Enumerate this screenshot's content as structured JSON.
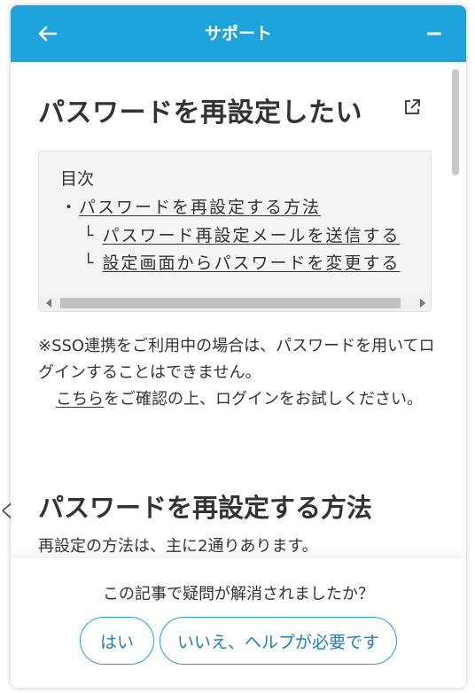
{
  "backdrop": {
    "partial_text": "く ⁄"
  },
  "header": {
    "title": "サポート",
    "back_icon": "arrow-left-icon",
    "minimize_icon": "minus-icon",
    "color": "#1ea3dd"
  },
  "article": {
    "title": "パスワードを再設定したい",
    "external_icon": "external-link-icon",
    "toc": {
      "heading": "目次",
      "items": [
        {
          "mark": "・",
          "label": "パスワードを再設定する方法"
        },
        {
          "mark": "└",
          "label": "パスワード再設定メールを送信する"
        },
        {
          "mark": "└",
          "label": "設定画面からパスワードを変更する"
        }
      ]
    },
    "note": {
      "line1": "※SSO連携をご利用中の場合は、パスワードを用いてログインすることはできません。",
      "link": "こちら",
      "line2_rest": "をご確認の上、ログインをお試しください。"
    },
    "section": {
      "title": "パスワードを再設定する方法",
      "text": "再設定の方法は、主に2通りあります。"
    }
  },
  "feedback": {
    "question": "この記事で疑問が解消されましたか？",
    "yes_label": "はい",
    "no_label": "いいえ、ヘルプが必要です"
  }
}
